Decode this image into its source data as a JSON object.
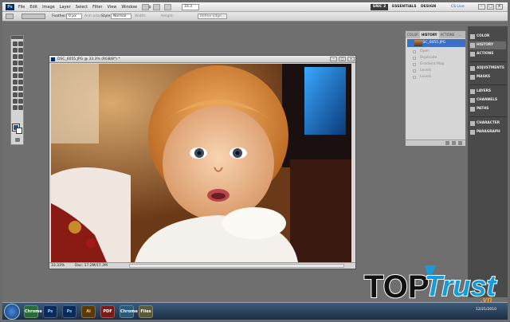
{
  "menubar": {
    "app_logo": "Ps",
    "menus": [
      "File",
      "Edit",
      "Image",
      "Layer",
      "Select",
      "Filter",
      "View",
      "Window",
      "Help"
    ],
    "zoom": "33.3",
    "workspaces": [
      "ERIC 2",
      "ESSENTIALS",
      "DESIGN"
    ],
    "cslive": "CS Live"
  },
  "options": {
    "feather_label": "Feather:",
    "feather_value": "0 px",
    "antialias": "Anti-alias",
    "style_label": "Style:",
    "style_value": "Normal",
    "width_label": "Width:",
    "height_label": "Height:",
    "refine_edge": "Refine Edge..."
  },
  "document": {
    "title": "DSC_6055.JPG @ 33.3% (RGB/8*) *",
    "zoom": "33.33%",
    "doc_info": "Doc: 17.2M/17.2M"
  },
  "history_panel": {
    "tabs": [
      "COLOR",
      "HISTORY",
      "ACTIONS",
      "..."
    ],
    "snapshot": "DSC_6055.JPG",
    "items": [
      "Open",
      "Duplicate",
      "Gradient Map",
      "Levels",
      "Levels"
    ]
  },
  "dock": {
    "group1": [
      "COLOR",
      "HISTORY",
      "ACTIONS"
    ],
    "group2": [
      "ADJUSTMENTS",
      "MASKS"
    ],
    "group3": [
      "LAYERS",
      "CHANNELS",
      "PATHS"
    ],
    "group4": [
      "CHARACTER",
      "PARAGRAPH"
    ]
  },
  "taskbar": {
    "apps": [
      "Chrome",
      "Ps",
      "Ps",
      "Ai",
      "PDF",
      "Chrome",
      "Files"
    ],
    "time_line": "12/21/2010"
  },
  "watermark": {
    "brand_top": "TOP",
    "brand_trust": "Trust",
    "brand_suffix": ".vn"
  },
  "colors": {
    "foreground": "#1a56a8",
    "background": "#ffffff",
    "selection": "#3c6fc6",
    "watermark_blue": "#1a9ad6"
  }
}
